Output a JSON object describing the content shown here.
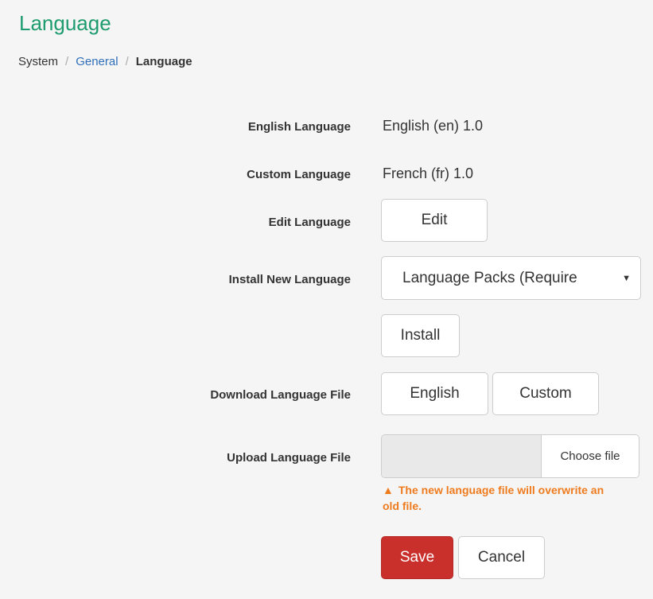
{
  "page": {
    "title": "Language"
  },
  "breadcrumb": {
    "items": [
      "System",
      "General",
      "Language"
    ],
    "separator": "/"
  },
  "form": {
    "english_language": {
      "label": "English Language",
      "value": "English (en) 1.0"
    },
    "custom_language": {
      "label": "Custom Language",
      "value": "French (fr) 1.0"
    },
    "edit_language": {
      "label": "Edit Language",
      "button": "Edit"
    },
    "install_new_language": {
      "label": "Install New Language",
      "select_value": "Language Packs (Require",
      "install_button": "Install"
    },
    "download_language_file": {
      "label": "Download Language File",
      "english_button": "English",
      "custom_button": "Custom"
    },
    "upload_language_file": {
      "label": "Upload Language File",
      "choose_button": "Choose file",
      "warning_icon": "warning-triangle-icon",
      "warning": "The new language file will overwrite an old file."
    },
    "actions": {
      "save": "Save",
      "cancel": "Cancel"
    }
  },
  "colors": {
    "title": "#1e9b6f",
    "link": "#2f6fba",
    "primary_button": "#c9302c",
    "warning": "#ee7b1e",
    "background": "#f5f5f5"
  }
}
